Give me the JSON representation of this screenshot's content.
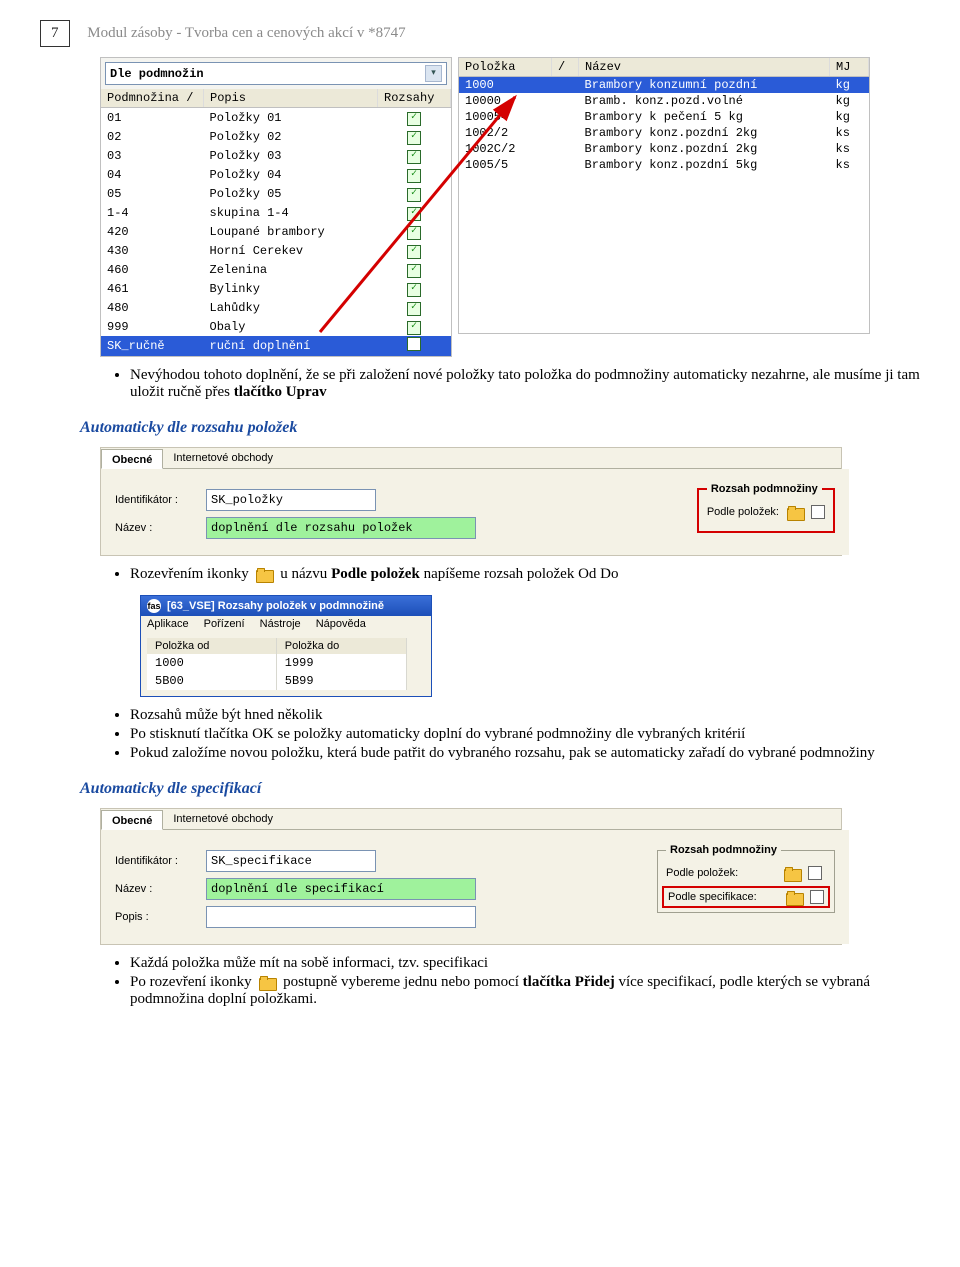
{
  "page": {
    "number": "7",
    "title": "Modul zásoby - Tvorba cen a cenových akcí v *8747"
  },
  "pane_left": {
    "combo_label": "Dle podmnožin",
    "headers": {
      "c1": "Podmnožina /",
      "c2": "Popis",
      "c3": "Rozsahy"
    },
    "rows": [
      {
        "c1": "01",
        "c2": "Položky 01",
        "chk": true
      },
      {
        "c1": "02",
        "c2": "Položky 02",
        "chk": true
      },
      {
        "c1": "03",
        "c2": "Položky 03",
        "chk": true
      },
      {
        "c1": "04",
        "c2": "Položky 04",
        "chk": true
      },
      {
        "c1": "05",
        "c2": "Položky 05",
        "chk": true
      },
      {
        "c1": "1-4",
        "c2": "skupina 1-4",
        "chk": true
      },
      {
        "c1": "420",
        "c2": "Loupané brambory",
        "chk": true
      },
      {
        "c1": "430",
        "c2": "Horní Cerekev",
        "chk": true
      },
      {
        "c1": "460",
        "c2": "Zelenina",
        "chk": true
      },
      {
        "c1": "461",
        "c2": "Bylinky",
        "chk": true
      },
      {
        "c1": "480",
        "c2": "Lahůdky",
        "chk": true
      },
      {
        "c1": "999",
        "c2": "Obaly",
        "chk": true
      },
      {
        "c1": "SK_ručně",
        "c2": "ruční doplnění",
        "chk": false,
        "sel": true
      }
    ]
  },
  "pane_right": {
    "headers": {
      "c1": "Položka",
      "c2": "/",
      "c3": "Název",
      "c4": "MJ"
    },
    "rows": [
      {
        "c1": "1000",
        "c3": "Brambory konzumní pozdní",
        "c4": "kg",
        "sel": true
      },
      {
        "c1": "10000",
        "c3": "Bramb. konz.pozd.volné",
        "c4": "kg"
      },
      {
        "c1": "100054",
        "c3": "Brambory k pečení 5 kg",
        "c4": "kg"
      },
      {
        "c1": "1002/2",
        "c3": "Brambory konz.pozdní 2kg",
        "c4": "ks"
      },
      {
        "c1": "1002C/2",
        "c3": "Brambory konz.pozdní 2kg",
        "c4": "ks"
      },
      {
        "c1": "1005/5",
        "c3": "Brambory konz.pozdní 5kg",
        "c4": "ks"
      }
    ]
  },
  "para1": {
    "text_a": "Nevýhodou tohoto doplnění, že se při založení nové položky tato položka do podmnožiny automaticky nezahrne, ale musíme ji tam uložit ručně přes ",
    "text_b": "tlačítko Uprav"
  },
  "sect1": "Automaticky dle rozsahu položek",
  "tabs1": {
    "active": "Obecné",
    "other": "Internetové obchody"
  },
  "form1": {
    "id_label": "Identifikátor :",
    "id_val": "SK_položky",
    "name_label": "Název :",
    "name_val": "doplnění dle rozsahu položek",
    "fs_legend": "Rozsah podmnožiny",
    "fs_row_label": "Podle položek:"
  },
  "line_icon1": {
    "a": "Rozevřením ikonky",
    "b": "u názvu ",
    "c": "Podle položek",
    "d": " napíšeme rozsah položek Od Do"
  },
  "rangewin": {
    "title": "[63_VSE] Rozsahy položek v podmnožině",
    "menu": [
      "Aplikace",
      "Pořízení",
      "Nástroje",
      "Nápověda"
    ],
    "h1": "Položka od",
    "h2": "Položka do",
    "rows": [
      {
        "a": "1000",
        "b": "1999"
      },
      {
        "a": "5B00",
        "b": "5B99"
      }
    ]
  },
  "bullets1": [
    "Rozsahů může být hned několik",
    "Po stisknutí tlačítka OK se položky automaticky doplní do vybrané podmnožiny dle vybraných kritérií",
    "Pokud založíme novou položku, která bude patřit do vybraného rozsahu, pak se automaticky zařadí do vybrané podmnožiny"
  ],
  "sect2": "Automaticky dle specifikací",
  "tabs2": {
    "active": "Obecné",
    "other": "Internetové obchody"
  },
  "form2": {
    "id_label": "Identifikátor :",
    "id_val": "SK_specifikace",
    "name_label": "Název :",
    "name_val": "doplnění dle specifikací",
    "popis_label": "Popis :",
    "popis_val": "",
    "fs_legend": "Rozsah podmnožiny",
    "row1": "Podle položek:",
    "row2": "Podle specifikace:"
  },
  "bullets2_a": "Každá položka může mít na sobě informaci, tzv. specifikaci",
  "line_icon2": {
    "a": "Po rozevření ikonky",
    "b": " postupně vybereme jednu nebo pomocí ",
    "c": "tlačítka Přidej",
    "d": " více specifikací, podle kterých se vybraná podmnožina doplní položkami."
  }
}
